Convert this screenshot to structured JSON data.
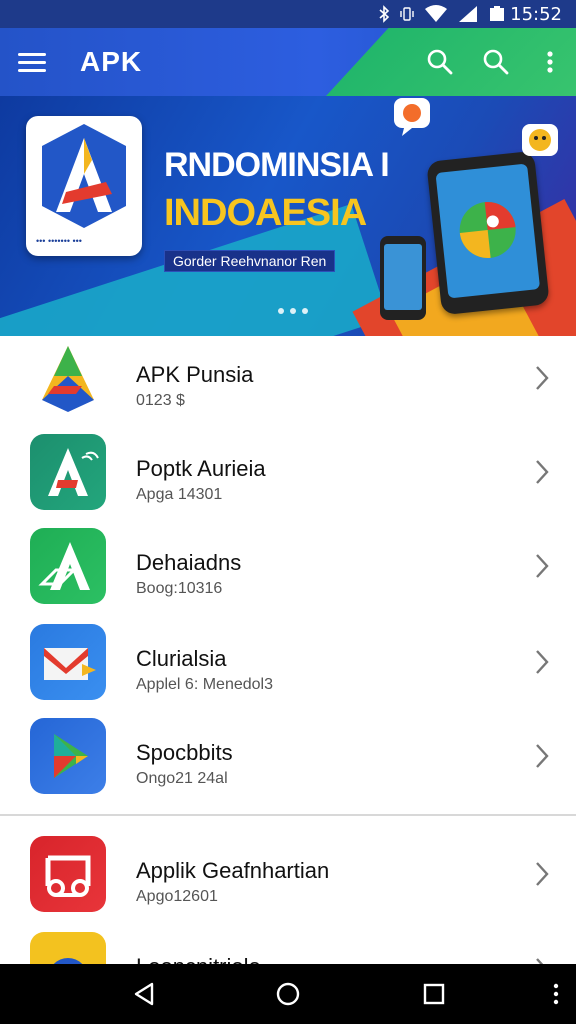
{
  "status_bar": {
    "time": "15:52"
  },
  "app_bar": {
    "brand": "APK"
  },
  "banner": {
    "title_line1": "RNDOMINSIA I",
    "title_line2": "INDOAESIA",
    "subtitle": "Gorder Reehvnanor Ren",
    "carousel_pages": 3
  },
  "apps": [
    {
      "name": "APK Punsia",
      "meta": "0123 $"
    },
    {
      "name": "Poptk Aurieia",
      "meta": "Apga 14301"
    },
    {
      "name": "Dehaiadns",
      "meta": "Boog:10316"
    },
    {
      "name": "Clurialsia",
      "meta": "Applel 6:  Menedol3"
    },
    {
      "name": "Spocbbits",
      "meta": "Ongo21 24al"
    },
    {
      "name": "Applik Geafnhartian",
      "meta": "Apgo12601"
    },
    {
      "name": "Looncnitriolo",
      "meta": ""
    }
  ],
  "colors": {
    "app_bar": "#2d5ee0",
    "accent_green": "#1db36a",
    "banner_yellow": "#f7c520"
  },
  "icons": [
    "menu-icon",
    "search-icon",
    "more-vert-icon",
    "chevron-right-icon",
    "back-icon",
    "home-icon",
    "recents-icon"
  ]
}
